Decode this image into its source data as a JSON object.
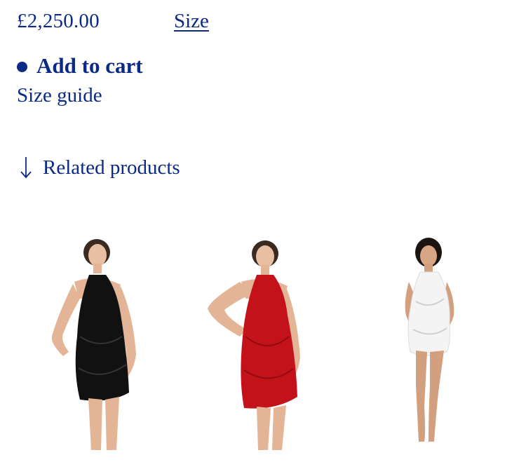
{
  "product": {
    "price": "£2,250.00",
    "size_label": "Size",
    "add_to_cart_label": "Add to cart",
    "size_guide_label": "Size guide"
  },
  "related": {
    "heading": "Related products",
    "items": [
      {
        "dress_color": "#111111",
        "image_name": "black-dress-model-image"
      },
      {
        "dress_color": "#c4121a",
        "image_name": "red-dress-model-image"
      },
      {
        "dress_color": "#f4f4f4",
        "image_name": "white-dress-model-image"
      }
    ]
  },
  "colors": {
    "brand": "#0a2a86",
    "background": "#ffffff"
  }
}
